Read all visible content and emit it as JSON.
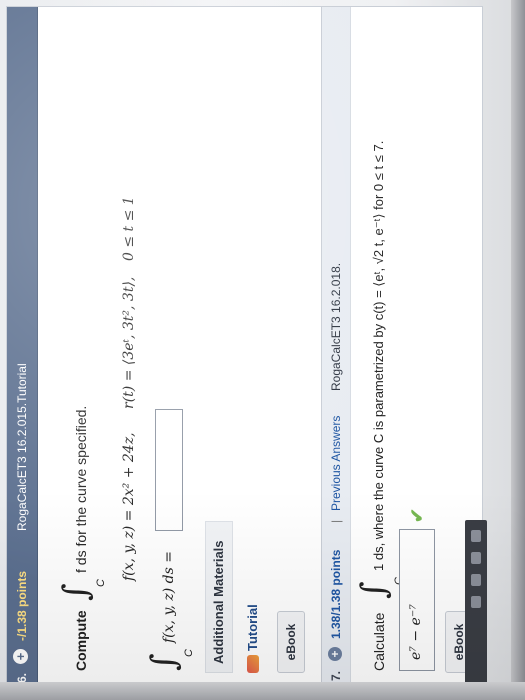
{
  "question6": {
    "number": "6.",
    "points": "-/1.38 points",
    "source": "RogaCalcET3 16.2.015.Tutorial",
    "compute_word": "Compute",
    "integral_symbol": "∫",
    "subscript": "C",
    "integrand_text": "f ds  for the curve specified.",
    "given_f": "f(x, y, z) = 2x² + 24z,",
    "given_r": "r(t) = ⟨3eᵗ, 3t², 3t⟩,",
    "interval": "0 ≤ t ≤ 1",
    "answer_lhs": "f(x, y, z) ds =",
    "answer_value": "",
    "additional_materials_title": "Additional Materials",
    "tutorial_label": "Tutorial",
    "ebook_label": "eBook"
  },
  "question7": {
    "number": "7.",
    "points": "1.38/1.38 points",
    "separator": "|",
    "previous_answers": "Previous Answers",
    "source": "RogaCalcET3 16.2.018.",
    "calculate_word": "Calculate",
    "integral_symbol": "∫",
    "subscript": "C",
    "prompt_text": "1 ds,  where the curve C is parametrized by  c(t) = ⟨eᵗ, √2 t, e⁻ᵗ⟩  for  0 ≤ t ≤ 7.",
    "answer_value": "e⁷ − e⁻⁷",
    "ebook_label": "eBook"
  },
  "colors": {
    "header_bg": "#5b6f8f",
    "points_text": "#ffe083",
    "link_blue": "#1f56a3",
    "correct_check": "#76b852"
  }
}
